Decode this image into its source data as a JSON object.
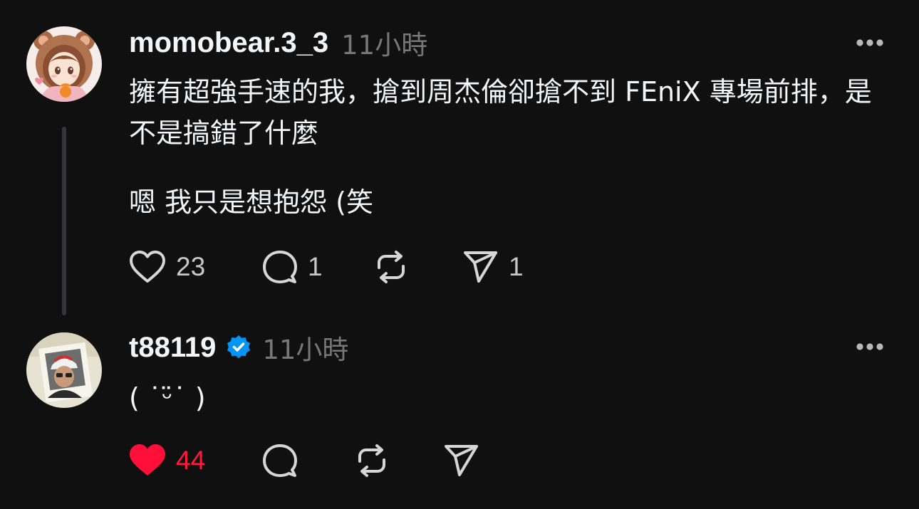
{
  "colors": {
    "background": "#101010",
    "text": "#f3f5f7",
    "muted": "#777777",
    "like_active": "#ff0f3a",
    "verified": "#0095f6"
  },
  "posts": [
    {
      "username": "momobear.3_3",
      "time": "11小時",
      "verified": false,
      "paragraphs": [
        "擁有超強手速的我，搶到周杰倫卻搶不到 FEniX 專場前排，是不是搞錯了什麼",
        "嗯 我只是想抱怨 (笑"
      ],
      "actions": {
        "like_count": "23",
        "liked": false,
        "reply_count": "1",
        "repost_count": "",
        "share_count": "1"
      },
      "icons": [
        "avatar",
        "more-icon",
        "heart-icon",
        "comment-icon",
        "repost-icon",
        "share-icon"
      ]
    },
    {
      "username": "t88119",
      "time": "11小時",
      "verified": true,
      "paragraphs": [
        "( ˙ᵕ̈˙ )"
      ],
      "actions": {
        "like_count": "44",
        "liked": true,
        "reply_count": "",
        "repost_count": "",
        "share_count": ""
      },
      "icons": [
        "avatar",
        "verified-badge-icon",
        "more-icon",
        "heart-filled-icon",
        "comment-icon",
        "repost-icon",
        "share-icon"
      ]
    }
  ]
}
